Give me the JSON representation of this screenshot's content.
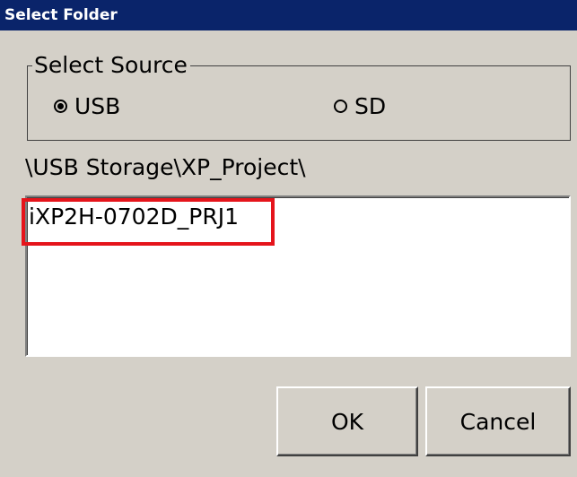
{
  "window": {
    "title": "Select Folder"
  },
  "source_group": {
    "label": "Select Source",
    "options": [
      {
        "label": "USB",
        "selected": true
      },
      {
        "label": "SD",
        "selected": false
      }
    ]
  },
  "path": {
    "value": "\\USB Storage\\XP_Project\\"
  },
  "folder_list": {
    "items": [
      "iXP2H-0702D_PRJ1"
    ],
    "highlight_color": "#e5141b"
  },
  "buttons": {
    "ok_label": "OK",
    "cancel_label": "Cancel"
  },
  "colors": {
    "titlebar": "#0a246a",
    "dialog_bg": "#d4d0c8"
  }
}
